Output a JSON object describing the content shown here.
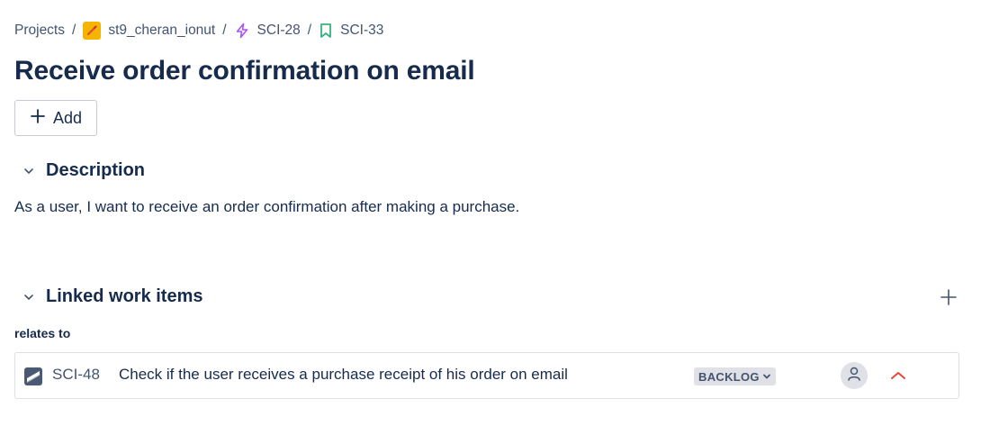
{
  "breadcrumb": {
    "projects": "Projects",
    "project": "st9_cheran_ionut",
    "epic": "SCI-28",
    "story": "SCI-33",
    "separator": "/"
  },
  "issue": {
    "title": "Receive order confirmation on email"
  },
  "toolbar": {
    "add_label": "Add"
  },
  "description": {
    "heading": "Description",
    "text": "As a user, I want to receive an order confirmation after making a purchase."
  },
  "linked": {
    "heading": "Linked work items",
    "relation": "relates to",
    "items": [
      {
        "key": "SCI-48",
        "summary": "Check if the user receives a purchase receipt of his order on email",
        "status": "BACKLOG",
        "type_icon": "subtask-icon",
        "priority_icon": "priority-high-icon"
      }
    ]
  },
  "colors": {
    "project_avatar": "#f5b400",
    "epic": "#a855f7",
    "story": "#36b37e",
    "priority": "#e5493a",
    "text": "#172b4d",
    "subtle_text": "#44546f"
  }
}
